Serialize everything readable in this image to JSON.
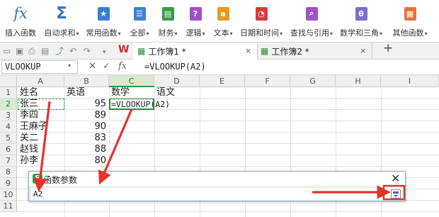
{
  "ribbon": {
    "buttons": [
      {
        "label": "插入函数",
        "icon": "fx-icon",
        "caret": ""
      },
      {
        "label": "自动求和",
        "icon": "sum-icon",
        "caret": "▾"
      },
      {
        "label": "常用函数",
        "icon": "star-icon",
        "caret": "▾",
        "color": "#3b7fd4",
        "glyph": "★"
      },
      {
        "label": "全部",
        "icon": "list-icon",
        "caret": "▾",
        "color": "#3b7fd4",
        "glyph": "☰"
      },
      {
        "label": "财务",
        "icon": "finance-icon",
        "caret": "▾",
        "color": "#3b9a4a",
        "glyph": "▤"
      },
      {
        "label": "逻辑",
        "icon": "logic-icon",
        "caret": "▾",
        "color": "#a34fc7",
        "glyph": "?"
      },
      {
        "label": "文本",
        "icon": "text-icon",
        "caret": "▾",
        "color": "#e69a1e",
        "glyph": "a"
      },
      {
        "label": "日期和时间",
        "icon": "clock-icon",
        "caret": "▾",
        "color": "#d93b3b",
        "glyph": "◔"
      },
      {
        "label": "查找与引用",
        "icon": "lookup-icon",
        "caret": "▾",
        "color": "#a34fc7",
        "glyph": "⌕"
      },
      {
        "label": "数学和三角",
        "icon": "math-icon",
        "caret": "▾",
        "color": "#7b6dd0",
        "glyph": "θ"
      },
      {
        "label": "其他函数",
        "icon": "other-icon",
        "caret": "▾",
        "color": "#e8733a",
        "glyph": "▦"
      }
    ]
  },
  "tabs": [
    {
      "label": "工作簿1 *",
      "close": "×"
    },
    {
      "label": "工作簿2 *",
      "close": "×"
    }
  ],
  "new_tab": "+",
  "namebox": {
    "value": "VLOOKUP",
    "caret": "▾"
  },
  "formula_bar": {
    "cancel": "✕",
    "confirm": "✓",
    "fx": "fx",
    "content": "=VLOOKUP(A2)"
  },
  "columns": [
    "A",
    "B",
    "C",
    "D",
    "E",
    "F",
    "G",
    "H",
    "I"
  ],
  "rows": [
    "1",
    "2",
    "3",
    "4",
    "5",
    "6",
    "7",
    "8",
    "9",
    "10",
    "11"
  ],
  "cells": {
    "A1": "姓名",
    "B1": "英语",
    "C1": "数学",
    "D1": "语文",
    "A2": "张三",
    "B2": "95",
    "C2": "=VLOOKUP(A2)",
    "A3": "李四",
    "B3": "89",
    "A4": "王麻子",
    "B4": "90",
    "A5": "关二",
    "B5": "83",
    "A6": "赵钱",
    "B6": "88",
    "A7": "孙李",
    "B7": "80"
  },
  "dialog": {
    "title": "函数参数",
    "logo": "S",
    "close": "✕",
    "input_value": "A2"
  },
  "colors": {
    "accent_green": "#2f9a42",
    "arrow_red": "#e8322a",
    "dialog_bg": "#e9f3e6"
  }
}
